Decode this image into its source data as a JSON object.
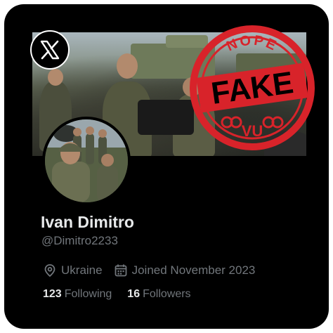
{
  "profile": {
    "name": "Ivan Dimitro",
    "handle": "@Dimitro2233",
    "location": "Ukraine",
    "joined": "Joined November 2023",
    "following_count": "123",
    "following_label": "Following",
    "followers_count": "16",
    "followers_label": "Followers"
  },
  "stamp": {
    "top": "NOPE",
    "main": "FAKE",
    "bottom": "VU",
    "color": "#d8232a"
  },
  "icons": {
    "brand": "x-logo-icon",
    "location": "location-pin-icon",
    "calendar": "calendar-icon"
  },
  "colors": {
    "background": "#000000",
    "primary_text": "#e7e9ea",
    "secondary_text": "#71767b"
  }
}
